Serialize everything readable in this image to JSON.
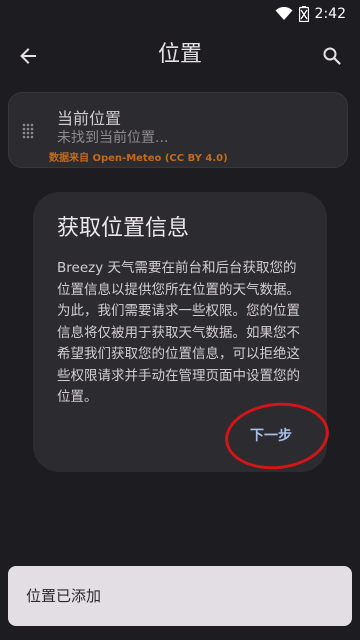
{
  "status_bar": {
    "time": "2:42",
    "icons": [
      "wifi-icon",
      "battery-icon"
    ]
  },
  "toolbar": {
    "title": "位置",
    "back_icon": "arrow-back-icon",
    "search_icon": "search-icon"
  },
  "location_card": {
    "title": "当前位置",
    "subtitle": "未找到当前位置...",
    "source": "数据来自 Open-Meteo (CC BY 4.0)",
    "handle_icon": "drag-handle-icon"
  },
  "dialog": {
    "title": "获取位置信息",
    "body": "Breezy 天气需要在前台和后台获取您的位置信息以提供您所在位置的天气数据。为此，我们需要请求一些权限。您的位置信息将仅被用于获取天气数据。如果您不希望我们获取您的位置信息，可以拒绝这些权限请求并手动在管理页面中设置您的位置。",
    "next_label": "下一步"
  },
  "snackbar": {
    "text": "位置已添加"
  },
  "colors": {
    "background": "#1d1d21",
    "card": "#2b2b30",
    "dialog": "#2c2b30",
    "source_text": "#c46a1c",
    "button_text": "#a8c0e6",
    "annotation": "#d01616",
    "snackbar": "#e2dee4"
  }
}
